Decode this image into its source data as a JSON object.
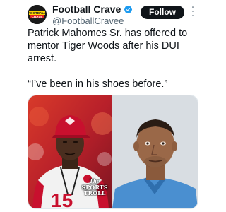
{
  "author": {
    "display_name": "Football Crave",
    "handle": "@FootballCravee",
    "avatar_text_line1": "FOOTBALL",
    "avatar_text_line2": "CRAVE",
    "verified": true
  },
  "actions": {
    "follow_label": "Follow"
  },
  "tweet": {
    "text_line1": "Patrick Mahomes Sr. has offered to mentor Tiger Woods after his DUI arrest.",
    "text_line2": "“I’ve been in his shoes before.”"
  },
  "media": {
    "left_jersey_number": "15",
    "watermark_the": "The",
    "watermark_line1": "SPORTS",
    "watermark_line2": "TROLL"
  },
  "colors": {
    "accent": "#1d9bf0",
    "text": "#0f1419",
    "secondary_text": "#536471",
    "follow_bg": "#0f1419",
    "chiefs_red": "#c8102e"
  }
}
